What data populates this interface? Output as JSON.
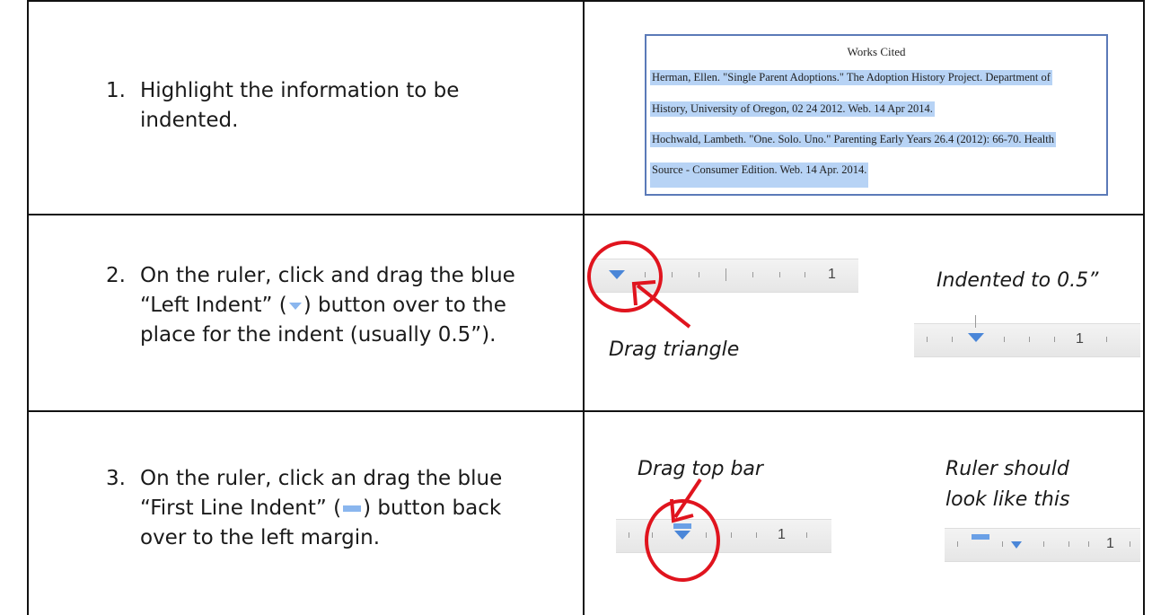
{
  "steps": [
    {
      "num": "1.",
      "line1": "Highlight the information to be",
      "line2": "indented."
    },
    {
      "num": "2.",
      "line1": "On the ruler, click and drag the blue",
      "line2a": "“Left Indent” (",
      "line2b": ") button over to the",
      "line3": "place for the indent (usually 0.5”)."
    },
    {
      "num": "3.",
      "line1": "On the ruler, click an drag the blue",
      "line2a": "“First Line Indent” (",
      "line2b": ") button back",
      "line3": "over to the left margin."
    }
  ],
  "works_cited": {
    "title": "Works Cited",
    "lines": [
      "Herman, Ellen. \"Single Parent Adoptions.\" The Adoption History Project. Department of",
      "History, University of Oregon, 02 24 2012. Web. 14 Apr 2014.",
      "Hochwald, Lambeth. \"One. Solo. Uno.\" Parenting Early Years 26.4 (2012): 66-70. Health",
      "Source - Consumer Edition. Web. 14 Apr. 2014."
    ]
  },
  "labels": {
    "drag_triangle": "Drag triangle",
    "indented_to": "Indented to 0.5”",
    "drag_top_bar": "Drag top bar",
    "ruler_should_1": "Ruler should",
    "ruler_should_2": "look like this"
  },
  "ruler_number": "1",
  "colors": {
    "circle": "#e0141e",
    "indent_marker": "#4a86d8",
    "highlight": "#b7d3f5"
  }
}
